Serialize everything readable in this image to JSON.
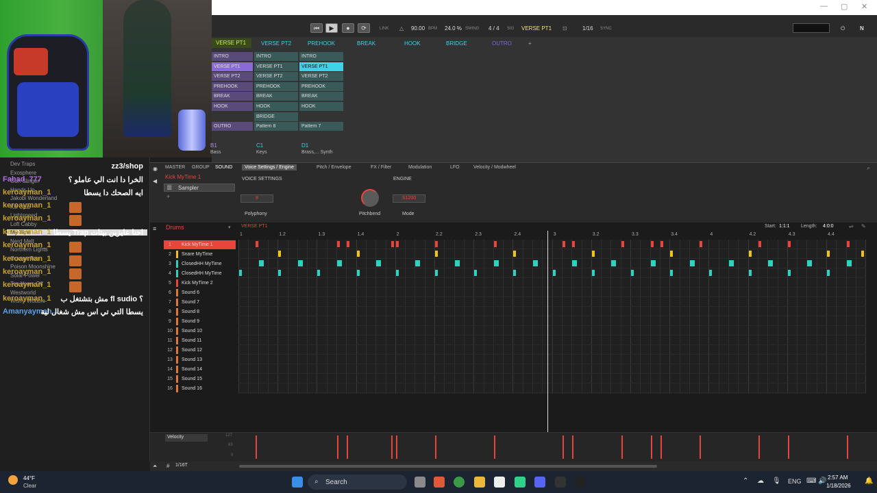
{
  "webcam": {
    "label": "webcam-feed"
  },
  "library": {
    "items": [
      "Dev Traps",
      "Exosphere",
      "Gun Slinger",
      "Hands Up",
      "Jakobi Wonderland",
      "Kill Club",
      "Lightspeed",
      "Loft Cabby",
      "My Time",
      "Nerd Melt",
      "Northern Lights",
      "Orange Ten",
      "Poison Moonshine",
      "Solar Power",
      "Ten Years Off",
      "Westworld",
      "Wishy Wobble"
    ],
    "selected": "My Time"
  },
  "chat": [
    {
      "name": "",
      "msg": "zz3/shop"
    },
    {
      "name": "Fahad_777",
      "msg": "الخرا دا انت الي عاملو ؟"
    },
    {
      "name": "keroayman_1",
      "msg": "ايه الصحك دا يسطا"
    },
    {
      "name": "keroayman_1",
      "msg": ""
    },
    {
      "name": "keroayman_1",
      "msg": ""
    },
    {
      "name": "keroayman_1",
      "msg": "يسطا Trap احنا عايزين بيتات"
    },
    {
      "name": "keroayman_1",
      "msg": ""
    },
    {
      "name": "keroayman_1",
      "msg": ""
    },
    {
      "name": "keroayman_1",
      "msg": ""
    },
    {
      "name": "keroayman_1",
      "msg": ""
    },
    {
      "name": "keroayman_1",
      "msg": "مش بتشتغل ب fl sudio ؟"
    },
    {
      "name": "Amanyayman...",
      "msg": "يسطا التي تي اس مش شغال لية"
    }
  ],
  "transport": {
    "link": "LINK",
    "bpm": "90.00",
    "bpm_unit": "BPM",
    "swing": "24.0 %",
    "swing_unit": "SWING",
    "sig": "4 / 4",
    "sig_unit": "SIG",
    "scene": "VERSE PT1",
    "quant": "1/16",
    "sync": "SYNC"
  },
  "scenes": [
    "VERSE PT1",
    "VERSE PT2",
    "PREHOOK",
    "BREAK",
    "HOOK",
    "BRIDGE",
    "OUTRO",
    "+"
  ],
  "pattern_columns": [
    {
      "items": [
        "INTRO",
        "VERSE PT1",
        "VERSE PT2",
        "PREHOOK",
        "BREAK",
        "HOOK",
        "",
        "OUTRO"
      ],
      "group": "B1",
      "group_sub": "Bass"
    },
    {
      "items": [
        "INTRO",
        "VERSE PT1",
        "VERSE PT2",
        "PREHOOK",
        "BREAK",
        "HOOK",
        "BRIDGE",
        "Pattern 8"
      ],
      "group": "C1",
      "group_sub": "Keys"
    },
    {
      "items": [
        "INTRO",
        "VERSE PT1",
        "VERSE PT2",
        "PREHOOK",
        "BREAK",
        "HOOK",
        "",
        "Pattern 7"
      ],
      "group": "D1",
      "group_sub": "Brass,... Synth"
    }
  ],
  "editor": {
    "level_tabs": [
      "MASTER",
      "GROUP",
      "SOUND"
    ],
    "sound_name": "Kick MyTime 1",
    "plugin": "Sampler",
    "tabs": [
      "Voice Settings / Engine",
      "Pitch / Envelope",
      "FX / Filter",
      "Modulation",
      "LFO",
      "Velocity / Modwheel"
    ],
    "voice_settings": "VOICE SETTINGS",
    "engine": "ENGINE",
    "polyphony_val": "8",
    "polyphony": "Polyphony",
    "pitchbend": "Pitchbend",
    "mode_val": "S1200",
    "mode": "Mode"
  },
  "pattern": {
    "group_label": "Drums",
    "pattern_name": "VERSE PT1",
    "start_label": "Start:",
    "start": "1:1:1",
    "length_label": "Length:",
    "length": "4:0:0",
    "ruler": [
      "1",
      "1.2",
      "1.3",
      "1.4",
      "2",
      "2.2",
      "2.3",
      "2.4",
      "3",
      "3.2",
      "3.3",
      "3.4",
      "4",
      "4.2",
      "4.3",
      "4.4"
    ],
    "sounds": [
      "Kick MyTime 1",
      "Snare MyTime",
      "ClosedHH MyTime",
      "ClosedHH MyTime",
      "Kick MyTime 2",
      "Sound 6",
      "Sound 7",
      "Sound 8",
      "Sound 9",
      "Sound 10",
      "Sound 11",
      "Sound 12",
      "Sound 13",
      "Sound 14",
      "Sound 15",
      "Sound 16"
    ],
    "velocity_label": "Velocity",
    "vel_ticks": [
      "127",
      "63",
      "0"
    ],
    "grid_label": "1/16T"
  },
  "taskbar": {
    "temp": "44°F",
    "weather": "Clear",
    "search": "Search",
    "lang": "ENG",
    "time": "2:57 AM",
    "date": "1/18/2026"
  },
  "colors": {
    "kick": "#e8453c",
    "snare": "#f2c40f",
    "hat": "#2fd1c0",
    "accent": "#3fd1e8"
  }
}
